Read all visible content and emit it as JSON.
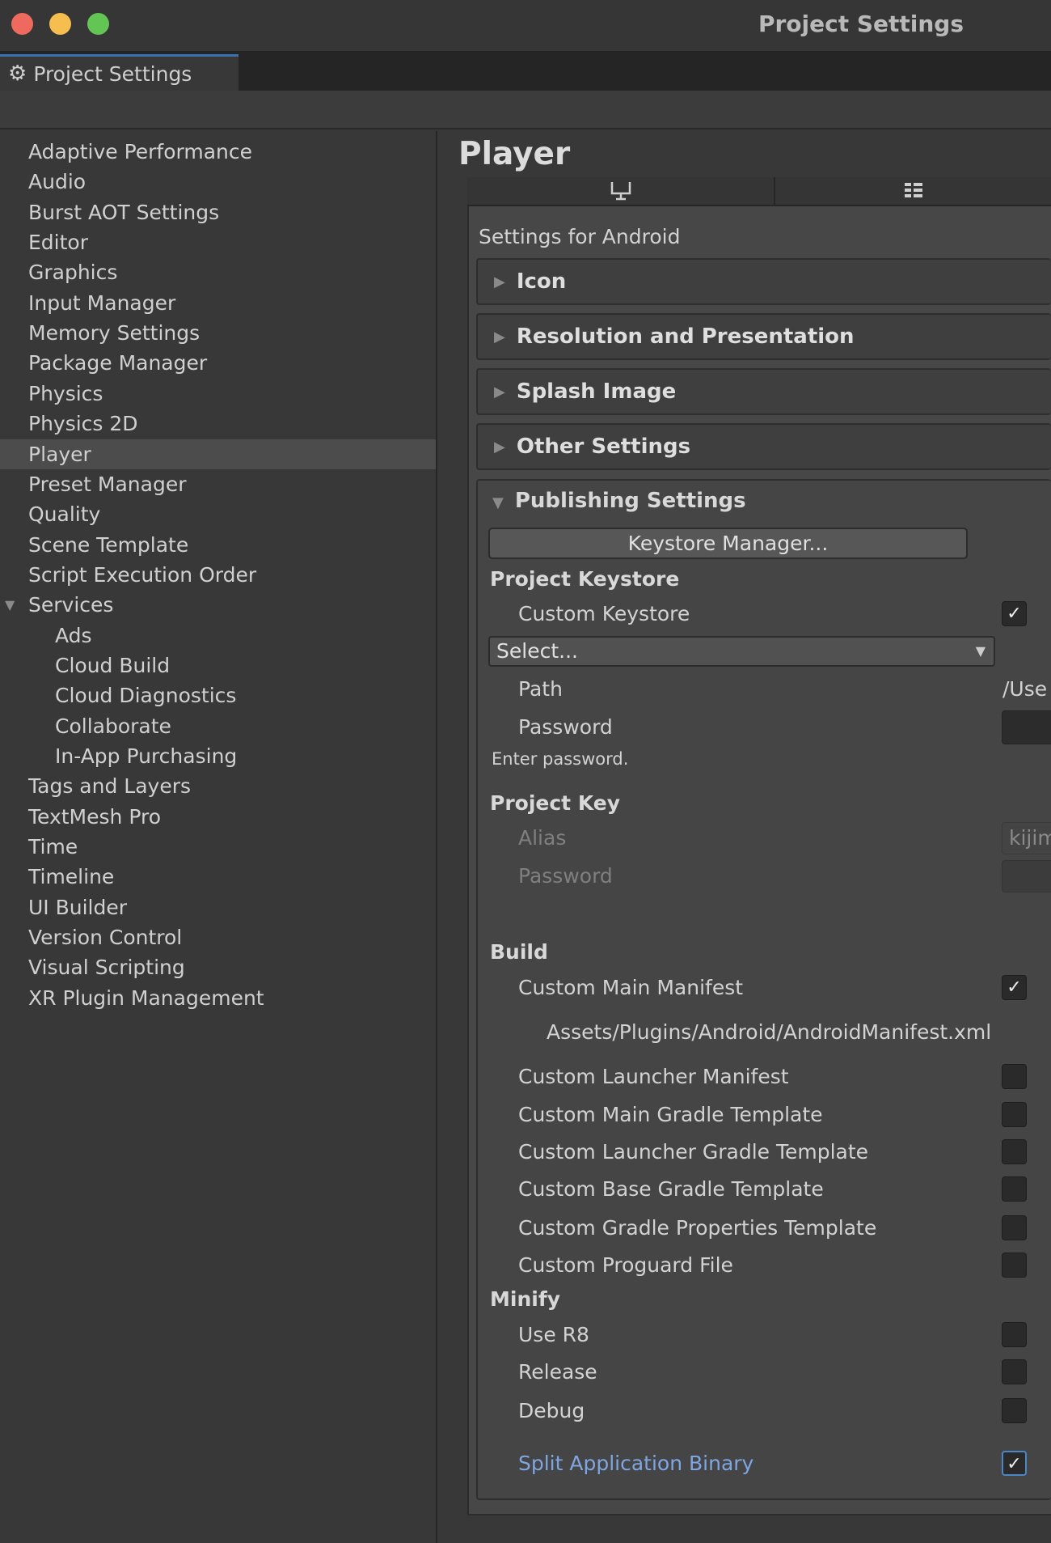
{
  "window": {
    "title": "Project Settings",
    "traffic_lights": {
      "close": "#ee6a5f",
      "minimize": "#f5be4f",
      "maximize": "#62c554"
    }
  },
  "tab": {
    "icon": "gear-icon",
    "label": "Project Settings",
    "accent": "#3a72b0"
  },
  "sidebar": {
    "selected": "Player",
    "items": [
      {
        "label": "Adaptive Performance",
        "level": 0
      },
      {
        "label": "Audio",
        "level": 0
      },
      {
        "label": "Burst AOT Settings",
        "level": 0
      },
      {
        "label": "Editor",
        "level": 0
      },
      {
        "label": "Graphics",
        "level": 0
      },
      {
        "label": "Input Manager",
        "level": 0
      },
      {
        "label": "Memory Settings",
        "level": 0
      },
      {
        "label": "Package Manager",
        "level": 0
      },
      {
        "label": "Physics",
        "level": 0
      },
      {
        "label": "Physics 2D",
        "level": 0
      },
      {
        "label": "Player",
        "level": 0
      },
      {
        "label": "Preset Manager",
        "level": 0
      },
      {
        "label": "Quality",
        "level": 0
      },
      {
        "label": "Scene Template",
        "level": 0
      },
      {
        "label": "Script Execution Order",
        "level": 0
      },
      {
        "label": "Services",
        "level": 0,
        "expanded": true
      },
      {
        "label": "Ads",
        "level": 1
      },
      {
        "label": "Cloud Build",
        "level": 1
      },
      {
        "label": "Cloud Diagnostics",
        "level": 1
      },
      {
        "label": "Collaborate",
        "level": 1
      },
      {
        "label": "In-App Purchasing",
        "level": 1
      },
      {
        "label": "Tags and Layers",
        "level": 0
      },
      {
        "label": "TextMesh Pro",
        "level": 0
      },
      {
        "label": "Time",
        "level": 0
      },
      {
        "label": "Timeline",
        "level": 0
      },
      {
        "label": "UI Builder",
        "level": 0
      },
      {
        "label": "Version Control",
        "level": 0
      },
      {
        "label": "Visual Scripting",
        "level": 0
      },
      {
        "label": "XR Plugin Management",
        "level": 0
      }
    ]
  },
  "main": {
    "title": "Player",
    "platform_tabs": [
      {
        "icon": "desktop-icon"
      },
      {
        "icon": "android-icon"
      }
    ],
    "settings_for": "Settings for Android",
    "foldouts": [
      "Icon",
      "Resolution and Presentation",
      "Splash Image",
      "Other Settings"
    ],
    "publishing": {
      "title": "Publishing Settings",
      "keystore_manager": "Keystore Manager...",
      "project_keystore": {
        "header": "Project Keystore",
        "custom_keystore": "Custom Keystore",
        "custom_keystore_checked": true,
        "select": "Select...",
        "path_label": "Path",
        "path_value": "/Use",
        "password_label": "Password",
        "hint": "Enter password."
      },
      "project_key": {
        "header": "Project Key",
        "alias_label": "Alias",
        "alias_value": "kijim",
        "password_label": "Password"
      },
      "build": {
        "header": "Build",
        "items": [
          {
            "label": "Custom Main Manifest",
            "checked": true
          },
          {
            "label": "Custom Launcher Manifest",
            "checked": false
          },
          {
            "label": "Custom Main Gradle Template",
            "checked": false
          },
          {
            "label": "Custom Launcher Gradle Template",
            "checked": false
          },
          {
            "label": "Custom Base Gradle Template",
            "checked": false
          },
          {
            "label": "Custom Gradle Properties Template",
            "checked": false
          },
          {
            "label": "Custom Proguard File",
            "checked": false
          }
        ],
        "manifest_path": "Assets/Plugins/Android/AndroidManifest.xml"
      },
      "minify": {
        "header": "Minify",
        "items": [
          {
            "label": "Use R8",
            "checked": false
          },
          {
            "label": "Release",
            "checked": false
          },
          {
            "label": "Debug",
            "checked": false
          }
        ]
      },
      "split_binary": {
        "label": "Split Application Binary",
        "checked": true,
        "color": "#7fa6e2"
      }
    }
  }
}
